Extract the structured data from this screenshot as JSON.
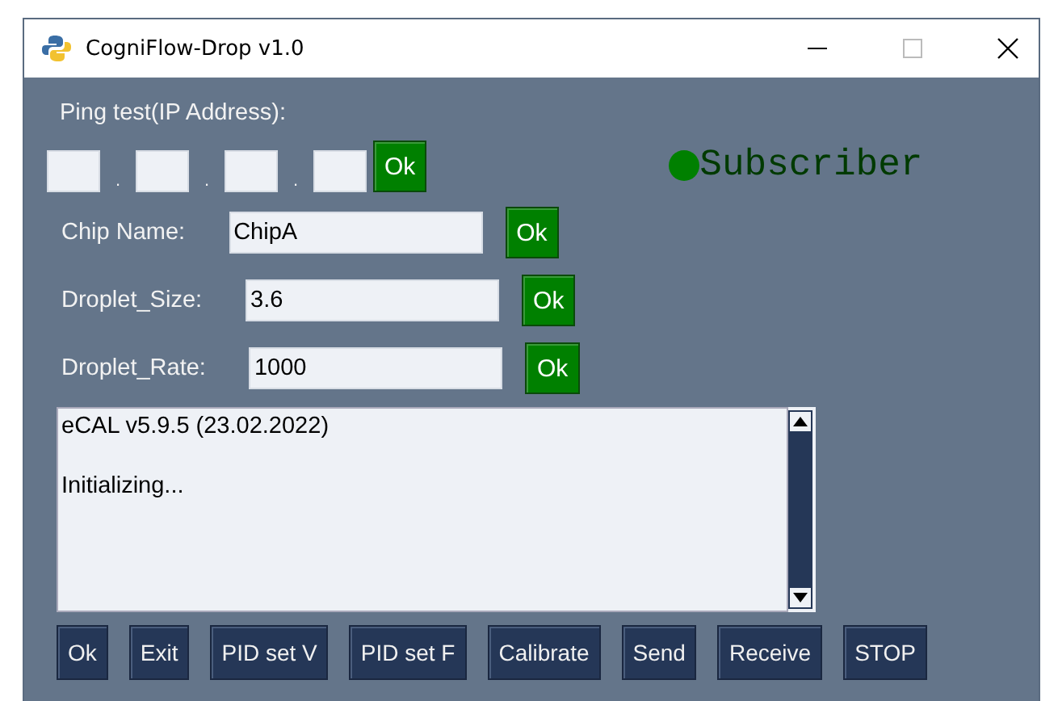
{
  "window": {
    "title": "CogniFlow-Drop v1.0"
  },
  "ping": {
    "label": "Ping test(IP Address):",
    "separators": [
      ".",
      ".",
      "."
    ],
    "button": "Ok"
  },
  "status": {
    "label": "Subscriber"
  },
  "params": [
    {
      "label": "Chip Name:",
      "value": "ChipA",
      "button": "Ok"
    },
    {
      "label": "Droplet_Size:",
      "value": "3.6",
      "button": "Ok"
    },
    {
      "label": "Droplet_Rate:",
      "value": "1000",
      "button": "Ok"
    }
  ],
  "log": [
    "eCAL v5.9.5 (23.02.2022)",
    "Initializing..."
  ],
  "buttons": [
    "Ok",
    "Exit",
    "PID set V",
    "PID set F",
    "Calibrate",
    "Send",
    "Receive",
    "STOP"
  ]
}
